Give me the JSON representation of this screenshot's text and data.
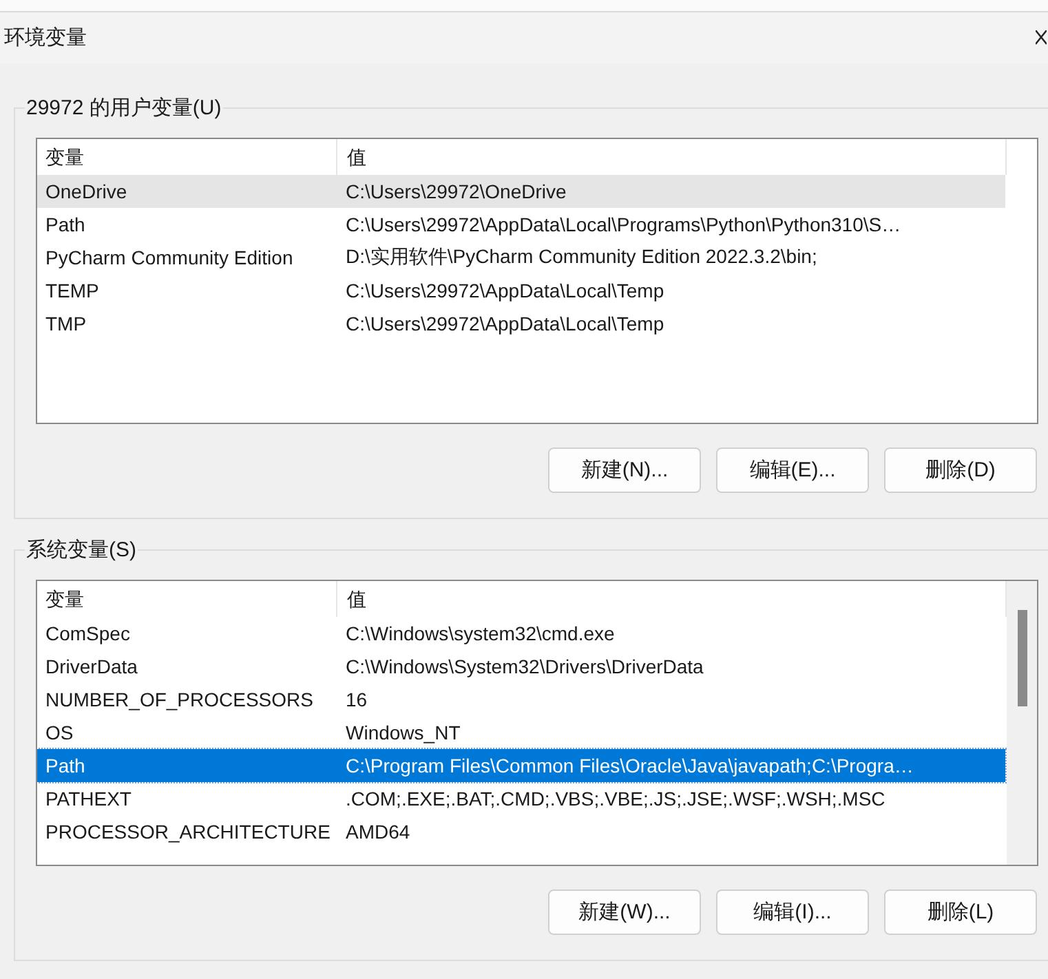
{
  "window": {
    "title": "环境变量"
  },
  "groups": [
    {
      "title": "29972 的用户变量(U)",
      "focused": false,
      "scrollbar": false,
      "columns": [
        "变量",
        "值"
      ],
      "rows": [
        {
          "name": "OneDrive",
          "value": "C:\\Users\\29972\\OneDrive",
          "selected": true
        },
        {
          "name": "Path",
          "value": "C:\\Users\\29972\\AppData\\Local\\Programs\\Python\\Python310\\S…",
          "selected": false
        },
        {
          "name": "PyCharm Community Edition",
          "value": "D:\\实用软件\\PyCharm Community Edition 2022.3.2\\bin;",
          "selected": false
        },
        {
          "name": "TEMP",
          "value": "C:\\Users\\29972\\AppData\\Local\\Temp",
          "selected": false
        },
        {
          "name": "TMP",
          "value": "C:\\Users\\29972\\AppData\\Local\\Temp",
          "selected": false
        }
      ],
      "buttons": [
        "新建(N)...",
        "编辑(E)...",
        "删除(D)"
      ]
    },
    {
      "title": "系统变量(S)",
      "focused": true,
      "scrollbar": true,
      "columns": [
        "变量",
        "值"
      ],
      "rows": [
        {
          "name": "ComSpec",
          "value": "C:\\Windows\\system32\\cmd.exe",
          "selected": false
        },
        {
          "name": "DriverData",
          "value": "C:\\Windows\\System32\\Drivers\\DriverData",
          "selected": false
        },
        {
          "name": "NUMBER_OF_PROCESSORS",
          "value": "16",
          "selected": false
        },
        {
          "name": "OS",
          "value": "Windows_NT",
          "selected": false
        },
        {
          "name": "Path",
          "value": "C:\\Program Files\\Common Files\\Oracle\\Java\\javapath;C:\\Progra…",
          "selected": true
        },
        {
          "name": "PATHEXT",
          "value": ".COM;.EXE;.BAT;.CMD;.VBS;.VBE;.JS;.JSE;.WSF;.WSH;.MSC",
          "selected": false
        },
        {
          "name": "PROCESSOR_ARCHITECTURE",
          "value": "AMD64",
          "selected": false
        }
      ],
      "buttons": [
        "新建(W)...",
        "编辑(I)...",
        "删除(L)"
      ]
    }
  ]
}
